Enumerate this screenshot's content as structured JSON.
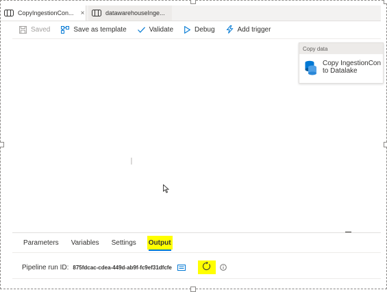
{
  "tabs": [
    {
      "label": "CopyIngestionCon...",
      "icon": "pipeline-icon",
      "active": true,
      "close": "×"
    },
    {
      "label": "datawarehouseInge...",
      "icon": "pipeline-icon",
      "active": false
    }
  ],
  "toolbar": {
    "saved_label": "Saved",
    "save_template_label": "Save as template",
    "validate_label": "Validate",
    "debug_label": "Debug",
    "add_trigger_label": "Add trigger"
  },
  "activity": {
    "type_label": "Copy data",
    "name_line1": "Copy IngestionCon",
    "name_line2": "to Datalake",
    "icon": "database-icon"
  },
  "panel": {
    "tabs": [
      "Parameters",
      "Variables",
      "Settings",
      "Output"
    ],
    "active_tab": "Output",
    "run_id_label": "Pipeline run ID:",
    "run_id_value": "875fdcac-cdea-449d-ab9f-fc9ef31dfcfe"
  },
  "colors": {
    "accent": "#0078d4",
    "highlight": "#ffff00",
    "disabled": "#a19f9d"
  }
}
